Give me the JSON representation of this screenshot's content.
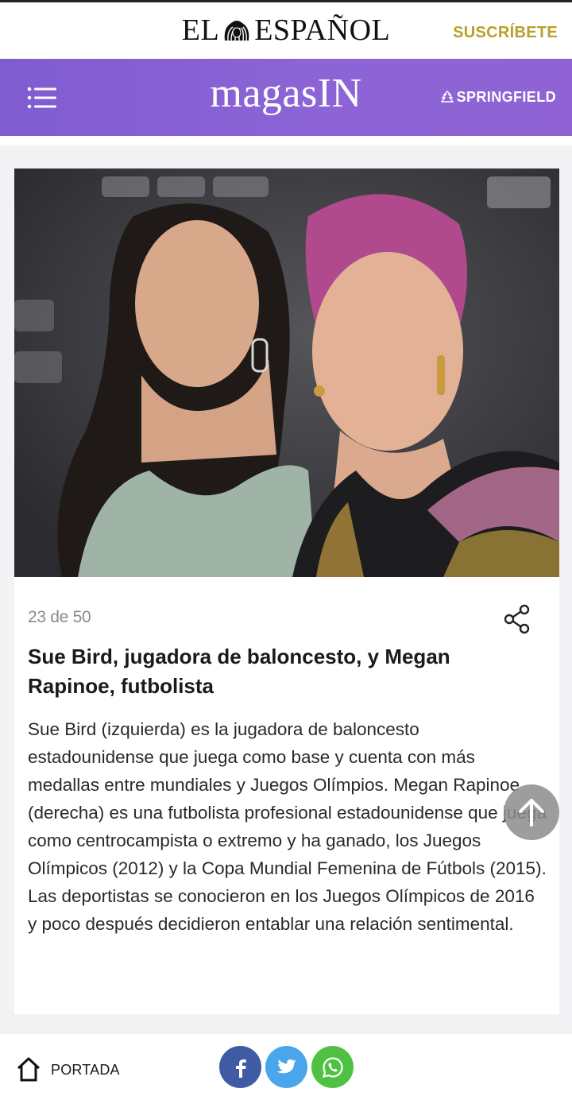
{
  "header": {
    "brand_left": "EL",
    "brand_right": "ESPAÑOL",
    "subscribe_label": "SUSCRÍBETE"
  },
  "section_bar": {
    "logo": "magasIN",
    "sponsor": "SPRINGFIELD"
  },
  "gallery": {
    "counter": "23 de 50",
    "headline": "Sue Bird, jugadora de baloncesto, y Megan Rapinoe, futbolista",
    "body": "Sue Bird (izquierda) es la jugadora de baloncesto estadounidense que juega como base y cuenta con más medallas entre mundiales y Juegos Olímpios. Megan Rapinoe (derecha) es una futbolista profesional estadounidense que juega como centrocampista o extremo y ha ganado, los Juegos Olímpicos (2012) y la Copa Mundial Femenina de Fútbols (2015). Las deportistas se conocieron en los Juegos Olímpicos de 2016 y poco después decidieron entablar una relación sentimental."
  },
  "bottom_bar": {
    "home_label": "PORTADA"
  },
  "colors": {
    "accent_purple": "#8c64d6",
    "subscribe_gold": "#b7a12a",
    "facebook": "#3e5ba3",
    "twitter": "#4aa6ea",
    "whatsapp": "#4fc142"
  },
  "icons": [
    "lion-icon",
    "menu-icon",
    "springfield-icon",
    "share-icon",
    "arrow-up-icon",
    "home-icon",
    "facebook-icon",
    "twitter-icon",
    "whatsapp-icon"
  ]
}
